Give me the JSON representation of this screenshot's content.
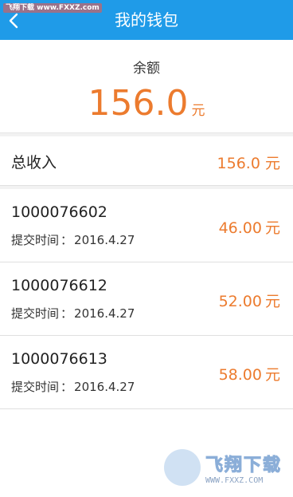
{
  "header": {
    "title": "我的钱包",
    "back_icon": "chevron-left-icon",
    "bg_color": "#1f9be8",
    "watermark": "飞翔下载 www.FXXZ.com"
  },
  "balance": {
    "label": "余额",
    "amount": "156.0",
    "unit": "元",
    "color": "#ec7b2e"
  },
  "income": {
    "label": "总收入",
    "value": "156.0",
    "unit": "元"
  },
  "records": [
    {
      "id": "1000076602",
      "time_label": "提交时间",
      "time_sep": "：",
      "date": "2016.4.27",
      "amount": "46.00",
      "unit": "元"
    },
    {
      "id": "1000076612",
      "time_label": "提交时间",
      "time_sep": "：",
      "date": "2016.4.27",
      "amount": "52.00",
      "unit": "元"
    },
    {
      "id": "1000076613",
      "time_label": "提交时间",
      "time_sep": "：",
      "date": "2016.4.27",
      "amount": "58.00",
      "unit": "元"
    }
  ],
  "watermark": {
    "brand": "飞翔下载",
    "url": "WWW.FXXZ.COM"
  }
}
